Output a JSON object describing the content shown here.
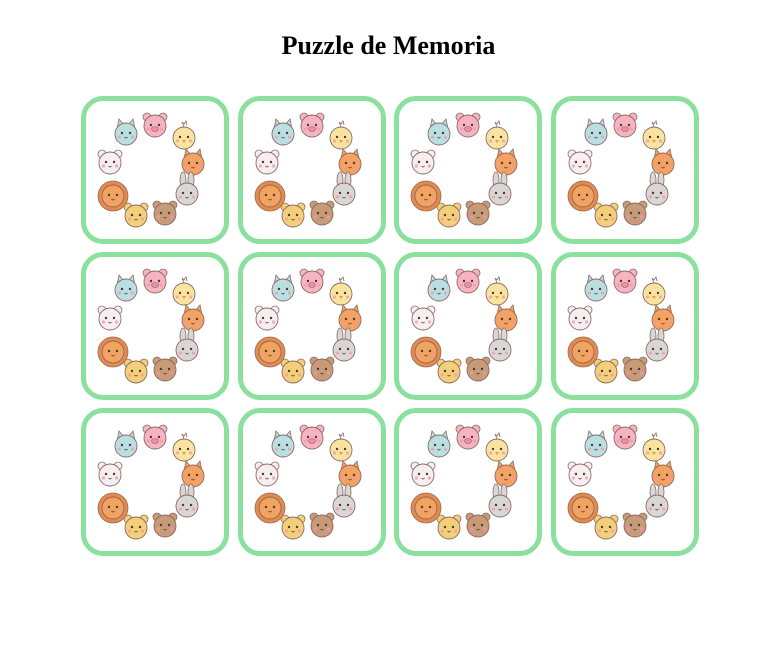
{
  "title": "Puzzle de Memoria",
  "board": {
    "rows": 3,
    "columns": 4,
    "card_back": {
      "border_color": "#8be09e",
      "icon": "animal-ring-card-back",
      "animals": [
        {
          "name": "cat-icon",
          "fill": "#b9dfe3"
        },
        {
          "name": "pig-icon",
          "fill": "#f6b3c2"
        },
        {
          "name": "chick-icon",
          "fill": "#f9e3a0"
        },
        {
          "name": "fox-icon",
          "fill": "#f4a262"
        },
        {
          "name": "bunny-icon",
          "fill": "#d9d6d6"
        },
        {
          "name": "dog-icon",
          "fill": "#c79a78"
        },
        {
          "name": "bear-icon",
          "fill": "#f3cf79"
        },
        {
          "name": "lion-icon",
          "fill": "#f0a45d"
        },
        {
          "name": "sheep-icon",
          "fill": "#f7eef2"
        }
      ]
    },
    "cards": [
      {
        "state": "face-down"
      },
      {
        "state": "face-down"
      },
      {
        "state": "face-down"
      },
      {
        "state": "face-down"
      },
      {
        "state": "face-down"
      },
      {
        "state": "face-down"
      },
      {
        "state": "face-down"
      },
      {
        "state": "face-down"
      },
      {
        "state": "face-down"
      },
      {
        "state": "face-down"
      },
      {
        "state": "face-down"
      },
      {
        "state": "face-down"
      }
    ]
  }
}
